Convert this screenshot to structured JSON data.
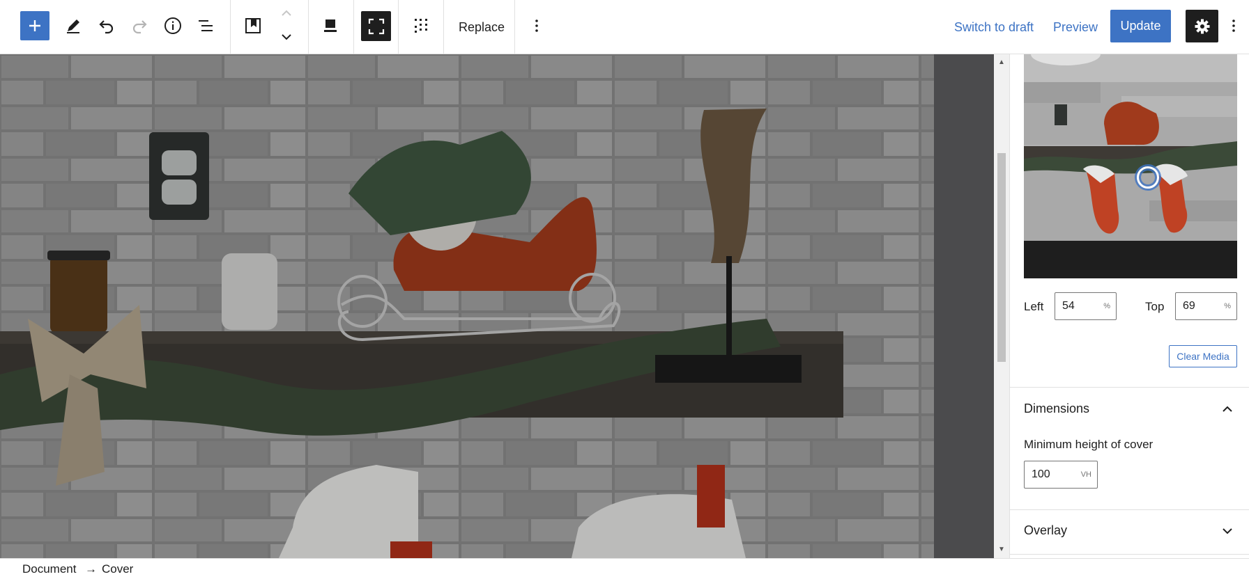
{
  "toolbar": {
    "inserter_label": "Add block",
    "replace_label": "Replace",
    "switch_draft_label": "Switch to draft",
    "preview_label": "Preview",
    "update_label": "Update"
  },
  "sidebar": {
    "focal_left_label": "Left",
    "focal_left_value": "54",
    "focal_left_unit": "%",
    "focal_top_label": "Top",
    "focal_top_value": "69",
    "focal_top_unit": "%",
    "clear_media_label": "Clear Media",
    "dimensions_title": "Dimensions",
    "min_height_label": "Minimum height of cover",
    "min_height_value": "100",
    "min_height_unit": "VH",
    "overlay_title": "Overlay"
  },
  "breadcrumb": {
    "items": [
      "Document",
      "Cover"
    ],
    "separator": "→"
  },
  "colors": {
    "accent": "#3d73c4",
    "dark": "#1e1e1e"
  }
}
